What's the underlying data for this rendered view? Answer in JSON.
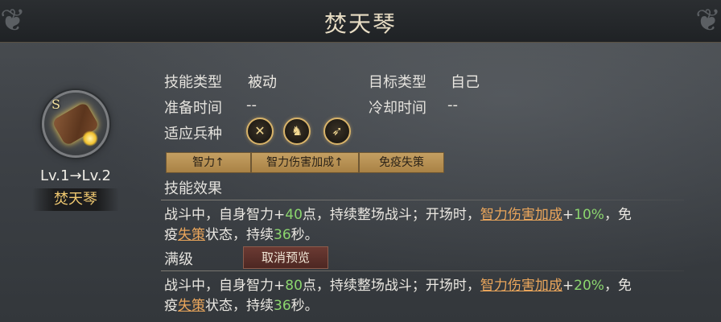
{
  "title": "焚天琴",
  "skill": {
    "level_text": "Lv.1→Lv.2",
    "name_tag": "焚天琴"
  },
  "info": {
    "skill_type_label": "技能类型",
    "skill_type_value": "被动",
    "target_type_label": "目标类型",
    "target_type_value": "自己",
    "prep_time_label": "准备时间",
    "prep_time_value": "--",
    "cooldown_label": "冷却时间",
    "cooldown_value": "--",
    "troop_label": "适应兵种"
  },
  "troop_icons": [
    "spear-cross-icon",
    "horse-head-icon",
    "bow-icon"
  ],
  "tags": [
    "智力↑",
    "智力伤害加成↑",
    "免疫失策"
  ],
  "effect": {
    "header": "技能效果",
    "line1": {
      "p1": "战斗中，自身智力+",
      "n1": "40",
      "p2": "点，持续整场战斗；开场时，",
      "link1": "智力伤害加成",
      "p3": "+",
      "n2": "10%",
      "p4": "，免"
    },
    "line2": {
      "p1": "疫",
      "link1": "失策",
      "p2": "状态，持续",
      "n1": "36",
      "p3": "秒。"
    }
  },
  "maxlevel": {
    "header": "满级",
    "cancel_button": "取消预览",
    "line1": {
      "p1": "战斗中，自身智力+",
      "n1": "80",
      "p2": "点，持续整场战斗；开场时，",
      "link1": "智力伤害加成",
      "p3": "+",
      "n2": "20%",
      "p4": "，免"
    },
    "line2": {
      "p1": "疫",
      "link1": "失策",
      "p2": "状态，持续",
      "n1": "36",
      "p3": "秒。"
    }
  }
}
